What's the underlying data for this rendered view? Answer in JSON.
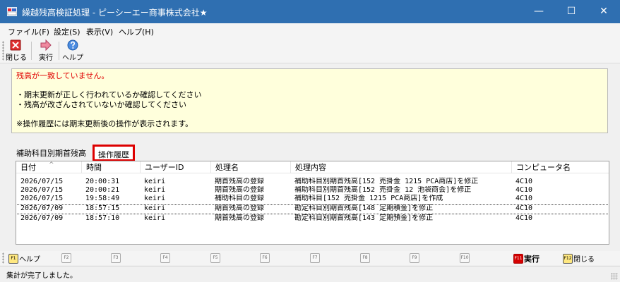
{
  "window": {
    "title": "繰越残高検証処理 - ピーシーエー商事株式会社★",
    "minimize_glyph": "—",
    "maximize_glyph": "☐",
    "close_glyph": "✕"
  },
  "menu": [
    "ファイル(F)",
    "設定(S)",
    "表示(V)",
    "ヘルプ(H)"
  ],
  "toolbar": {
    "close_label": "閉じる",
    "run_label": "実行",
    "help_label": "ヘルプ"
  },
  "message": {
    "headline": "残高が一致していません。",
    "line1": "・期末更新が正しく行われているか確認してください",
    "line2": "・残高が改ざんされていないか確認してください",
    "note": "※操作履歴には期末更新後の操作が表示されます。"
  },
  "tabs": {
    "tab1": "補助科目別期首残高",
    "tab2": "操作履歴"
  },
  "list": {
    "columns": [
      "日付",
      "時間",
      "ユーザーID",
      "処理名",
      "処理内容",
      "コンピュータ名"
    ],
    "sort_arrow": "^",
    "rows": [
      [
        "2026/07/15",
        "20:00:31",
        "keiri",
        "期首残高の登録",
        "補助科目別期首残高[152 売掛金 1215 PCA商店]を修正",
        "4C10"
      ],
      [
        "2026/07/15",
        "20:00:21",
        "keiri",
        "期首残高の登録",
        "補助科目別期首残高[152 売掛金 12 池袋商会]を修正",
        "4C10"
      ],
      [
        "2026/07/15",
        "19:58:49",
        "keiri",
        "補助科目の登録",
        "補助科目[152 売掛金 1215 PCA商店]を作成",
        "4C10"
      ],
      [
        "2026/07/09",
        "18:57:15",
        "keiri",
        "期首残高の登録",
        "勘定科目別期首残高[148 定期積金]を修正",
        "4C10"
      ],
      [
        "2026/07/09",
        "18:57:10",
        "keiri",
        "期首残高の登録",
        "勘定科目別期首残高[143 定期預金]を修正",
        "4C10"
      ]
    ]
  },
  "fkeys": {
    "f1": {
      "cap": "F1",
      "label": "ヘルプ"
    },
    "f2": "F2",
    "f3": "F3",
    "f4": "F4",
    "f5": "F5",
    "f6": "F6",
    "f7": "F7",
    "f8": "F8",
    "f9": "F9",
    "f10": "F10",
    "f11": {
      "cap": "F11",
      "label": "実行"
    },
    "f12": {
      "cap": "F12",
      "label": "閉じる"
    }
  },
  "status": "集計が完了しました。",
  "colors": {
    "titlebar": "#2f6fb1",
    "message_bg": "#ffffdc",
    "message_text": "#e00000",
    "tab_highlight": "#dd0000"
  }
}
